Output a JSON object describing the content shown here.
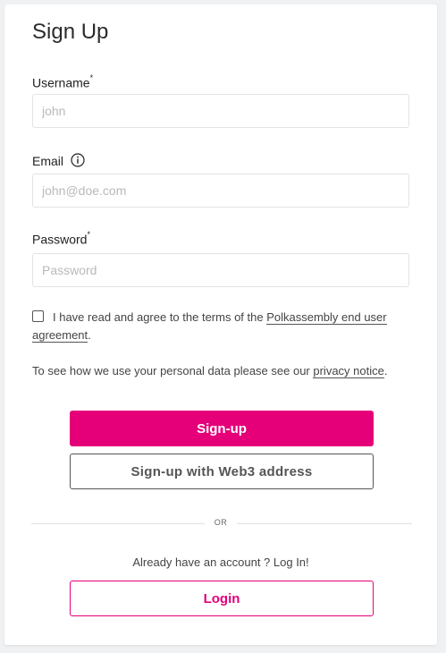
{
  "form": {
    "title": "Sign Up",
    "username": {
      "label": "Username",
      "required_mark": "*",
      "placeholder": "john",
      "value": ""
    },
    "email": {
      "label": "Email",
      "placeholder": "john@doe.com",
      "value": "",
      "info_icon": "info-circle-icon"
    },
    "password": {
      "label": "Password",
      "required_mark": "*",
      "placeholder": "Password",
      "value": ""
    },
    "terms": {
      "checked": false,
      "text_before": "I have read and agree to the terms of the ",
      "link_text": "Polkassembly end user agreement",
      "text_after": "."
    },
    "privacy": {
      "text_before": "To see how we use your personal data please see our ",
      "link_text": "privacy notice",
      "text_after": "."
    },
    "signup_label": "Sign-up",
    "web3_label": "Sign-up with Web3 address",
    "divider_text": "OR",
    "already_text": "Already have an account ? Log In!",
    "login_label": "Login"
  },
  "colors": {
    "accent": "#e5007a",
    "page_bg": "#f0f1f3",
    "card_bg": "#ffffff"
  }
}
